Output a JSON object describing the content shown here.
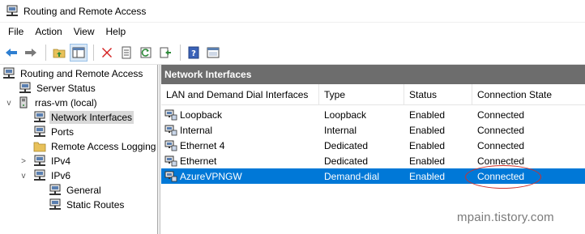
{
  "window": {
    "title": "Routing and Remote Access"
  },
  "menu": [
    {
      "label": "File"
    },
    {
      "label": "Action"
    },
    {
      "label": "View"
    },
    {
      "label": "Help"
    }
  ],
  "toolbar": {
    "icons": [
      "back-arrow-icon",
      "forward-arrow-icon",
      "up-folder-icon",
      "show-hide-tree-icon",
      "delete-icon",
      "properties-icon",
      "refresh-icon",
      "export-list-icon",
      "help-icon",
      "console-icon"
    ]
  },
  "tree": {
    "items": [
      {
        "label": "Routing and Remote Access",
        "icon": "rras-icon",
        "level": 0,
        "expander": ""
      },
      {
        "label": "Server Status",
        "icon": "server-status-icon",
        "level": 1,
        "expander": ""
      },
      {
        "label": "rras-vm (local)",
        "icon": "server-icon",
        "level": 1,
        "expander": "v"
      },
      {
        "label": "Network Interfaces",
        "icon": "network-interfaces-icon",
        "level": 2,
        "expander": "",
        "selected": true
      },
      {
        "label": "Ports",
        "icon": "ports-icon",
        "level": 2,
        "expander": ""
      },
      {
        "label": "Remote Access Logging",
        "icon": "folder-icon",
        "level": 2,
        "expander": ""
      },
      {
        "label": "IPv4",
        "icon": "ipv4-icon",
        "level": 2,
        "expander": ">"
      },
      {
        "label": "IPv6",
        "icon": "ipv6-icon",
        "level": 2,
        "expander": "v"
      },
      {
        "label": "General",
        "icon": "general-icon",
        "level": 3,
        "expander": ""
      },
      {
        "label": "Static Routes",
        "icon": "static-routes-icon",
        "level": 3,
        "expander": ""
      }
    ]
  },
  "panel": {
    "title": "Network Interfaces",
    "columns": [
      "LAN and Demand Dial Interfaces",
      "Type",
      "Status",
      "Connection State"
    ],
    "rows": [
      {
        "name": "Loopback",
        "type": "Loopback",
        "status": "Enabled",
        "state": "Connected"
      },
      {
        "name": "Internal",
        "type": "Internal",
        "status": "Enabled",
        "state": "Connected"
      },
      {
        "name": "Ethernet 4",
        "type": "Dedicated",
        "status": "Enabled",
        "state": "Connected"
      },
      {
        "name": "Ethernet",
        "type": "Dedicated",
        "status": "Enabled",
        "state": "Connected"
      },
      {
        "name": "AzureVPNGW",
        "type": "Demand-dial",
        "status": "Enabled",
        "state": "Connected",
        "selected": true
      }
    ]
  },
  "watermark": "mpain.tistory.com",
  "colors": {
    "selection": "#0078d7",
    "panel_header": "#6d6d6d",
    "annotation": "#d0302a"
  }
}
